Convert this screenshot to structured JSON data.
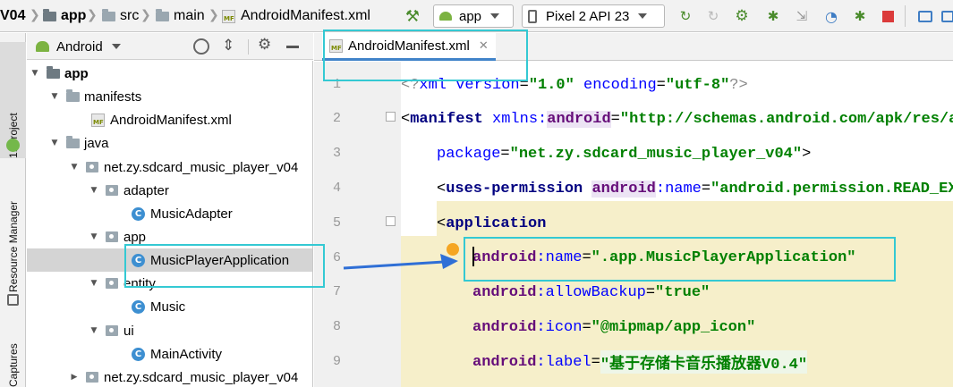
{
  "breadcrumb": {
    "project_tail": "V04",
    "items": [
      "app",
      "src",
      "main",
      "AndroidManifest.xml"
    ]
  },
  "toolbar": {
    "run_config": "app",
    "device": "Pixel 2 API 23"
  },
  "tool_strip": {
    "project_tab": "1: Project",
    "resource_manager_tab": "Resource Manager",
    "captures_tab": "Captures"
  },
  "project_panel": {
    "view_mode": "Android",
    "tree": [
      {
        "label": "app",
        "kind": "module",
        "expanded": true
      },
      {
        "label": "manifests",
        "kind": "folder",
        "expanded": true
      },
      {
        "label": "AndroidManifest.xml",
        "kind": "manifest"
      },
      {
        "label": "java",
        "kind": "folder",
        "expanded": true
      },
      {
        "label": "net.zy.sdcard_music_player_v04",
        "kind": "package",
        "expanded": true
      },
      {
        "label": "adapter",
        "kind": "package",
        "expanded": true
      },
      {
        "label": "MusicAdapter",
        "kind": "class"
      },
      {
        "label": "app",
        "kind": "package",
        "expanded": true
      },
      {
        "label": "MusicPlayerApplication",
        "kind": "class",
        "selected": true
      },
      {
        "label": "entity",
        "kind": "package",
        "expanded": true
      },
      {
        "label": "Music",
        "kind": "class"
      },
      {
        "label": "ui",
        "kind": "package",
        "expanded": true
      },
      {
        "label": "MainActivity",
        "kind": "class"
      },
      {
        "label": "net.zy.sdcard_music_player_v04",
        "kind": "package",
        "expanded": false
      }
    ]
  },
  "editor": {
    "tab_title": "AndroidManifest.xml",
    "line_numbers": [
      "1",
      "2",
      "3",
      "4",
      "5",
      "6",
      "7",
      "8",
      "9"
    ],
    "lines": [
      {
        "num": "1",
        "t": [
          "<?",
          "xml version",
          "=",
          "\"1.0\"",
          " encoding",
          "=",
          "\"utf-8\"",
          "?>"
        ]
      },
      {
        "num": "2",
        "t": [
          "<",
          "manifest ",
          "xmlns:",
          "android",
          "=",
          "\"http://schemas.android.com/apk/res/an"
        ]
      },
      {
        "num": "3",
        "t": [
          "package",
          "=",
          "\"net.zy.sdcard_music_player_v04\"",
          ">"
        ]
      },
      {
        "num": "4",
        "t": [
          "<",
          "uses-permission ",
          "android",
          ":",
          "name",
          "=",
          "\"android.permission.READ_EXT"
        ]
      },
      {
        "num": "5",
        "t": [
          "<",
          "application"
        ]
      },
      {
        "num": "6",
        "t": [
          "android",
          ":",
          "name",
          "=",
          "\".app.MusicPlayerApplication\""
        ]
      },
      {
        "num": "7",
        "t": [
          "android",
          ":",
          "allowBackup",
          "=",
          "\"true\""
        ]
      },
      {
        "num": "8",
        "t": [
          "android",
          ":",
          "icon",
          "=",
          "\"@mipmap/app_icon\""
        ]
      },
      {
        "num": "9",
        "t": [
          "android",
          ":",
          "label",
          "=",
          "\"基于存储卡音乐播放器V0.4\""
        ]
      }
    ]
  },
  "colors": {
    "annotation": "#34c9d3",
    "arrow": "#2f6fd6",
    "highlight": "#f6efca"
  }
}
